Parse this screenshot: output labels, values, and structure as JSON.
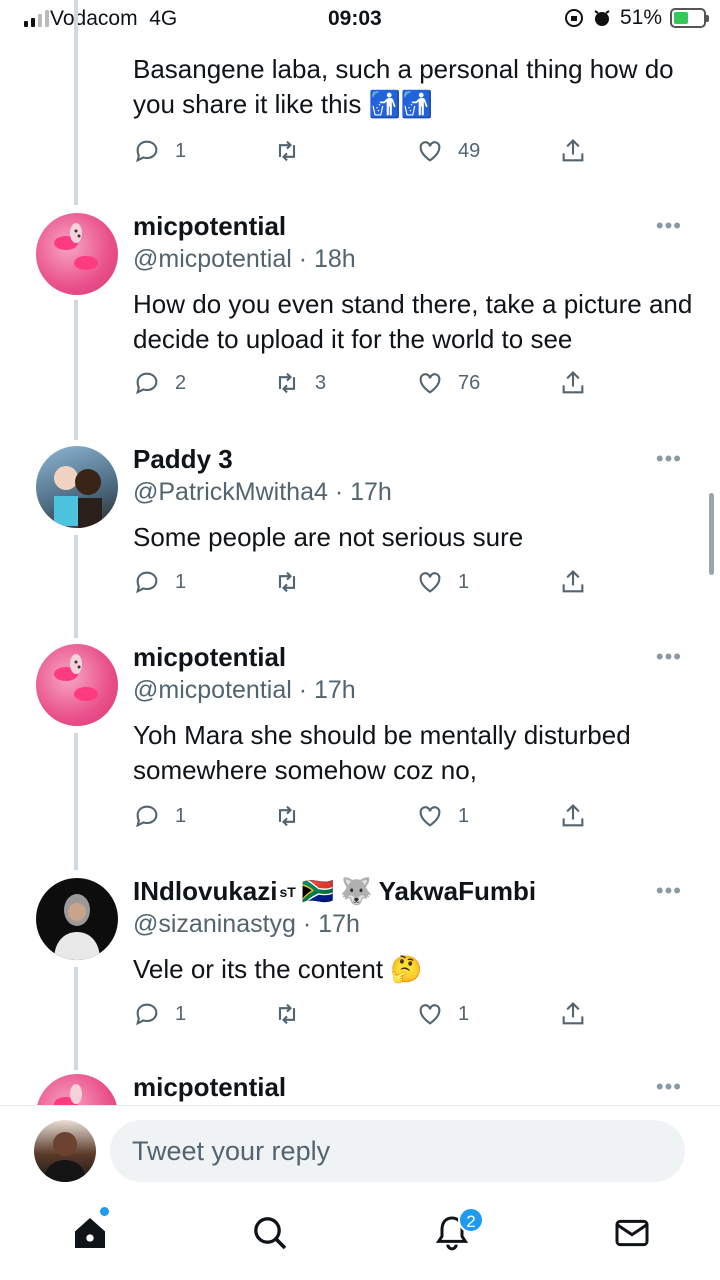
{
  "status_bar": {
    "carrier": "Vodacom",
    "network": "4G",
    "time": "09:03",
    "battery": "51%",
    "battery_level": 0.51
  },
  "colors": {
    "accent": "#1d9bf0",
    "secondary_text": "#536471",
    "thread_line": "#cfd9de"
  },
  "tweets": [
    {
      "name": "",
      "handle": "",
      "text": "Basangene laba, such a personal thing how do you share it like this 🚮🚮",
      "replies": "1",
      "retweets": "",
      "likes": "49"
    },
    {
      "name": "micpotential",
      "handle": "@micpotential · 18h",
      "text": "How do you even stand there, take a picture and decide to upload it for the world to see",
      "replies": "2",
      "retweets": "3",
      "likes": "76",
      "avatar_icon": "pink-nails-avatar"
    },
    {
      "name": "Paddy 3",
      "handle": "@PatrickMwitha4 · 17h",
      "text": "Some people are not serious sure",
      "replies": "1",
      "retweets": "",
      "likes": "1",
      "avatar_icon": "children-photo-avatar"
    },
    {
      "name": "micpotential",
      "handle": "@micpotential · 17h",
      "text": "Yoh Mara she should be mentally disturbed somewhere somehow coz no,",
      "replies": "1",
      "retweets": "",
      "likes": "1",
      "avatar_icon": "pink-nails-avatar"
    },
    {
      "name": "INdlovukazi",
      "name_sup": "sT",
      "name_flag": "🇿🇦",
      "name_emoji": "🐺",
      "name_suffix": "YakwaFumbi",
      "handle": "@sizaninastyg · 17h",
      "text": "Vele or its the content 🤔",
      "replies": "1",
      "retweets": "",
      "likes": "1",
      "avatar_icon": "man-in-hoodie-avatar"
    },
    {
      "name": "micpotential",
      "avatar_icon": "pink-nails-avatar"
    }
  ],
  "reply": {
    "placeholder": "Tweet your reply"
  },
  "tab_bar": {
    "notifications_badge": "2"
  }
}
